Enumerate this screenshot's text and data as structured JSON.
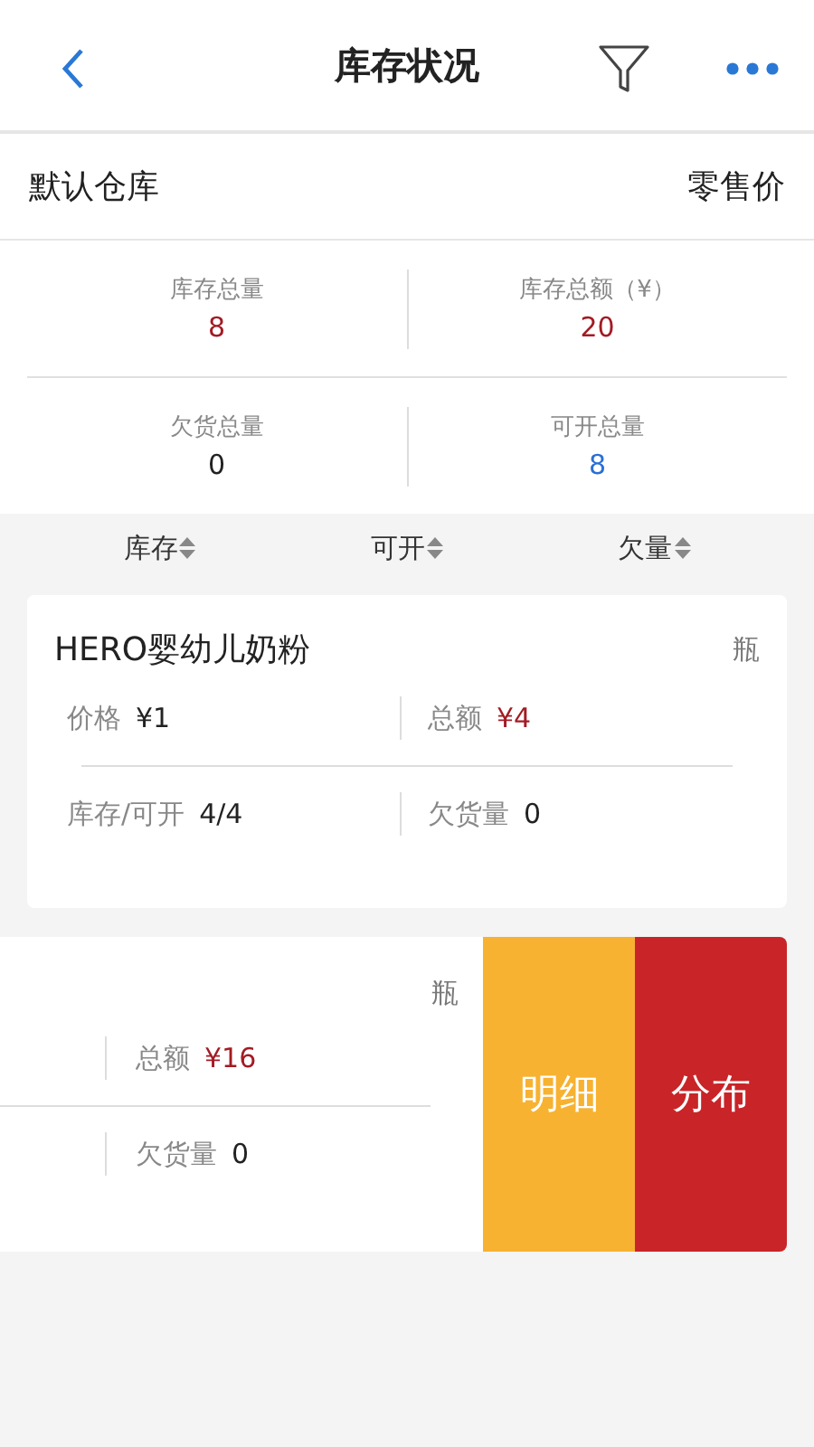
{
  "header": {
    "title": "库存状况"
  },
  "warehouse": {
    "name": "默认仓库",
    "price_type": "零售价"
  },
  "stats": [
    {
      "label": "库存总量",
      "value": "8",
      "color": "#a31b24"
    },
    {
      "label": "库存总额（¥）",
      "value": "20",
      "color": "#a31b24"
    },
    {
      "label": "欠货总量",
      "value": "0",
      "color": "#222222"
    },
    {
      "label": "可开总量",
      "value": "8",
      "color": "#2a6fd6"
    }
  ],
  "sort_columns": [
    "库存",
    "可开",
    "欠量"
  ],
  "items": [
    {
      "kind": "full",
      "name": "HERO婴幼儿奶粉",
      "unit": "瓶",
      "price_label": "价格",
      "price": "¥1",
      "total_label": "总额",
      "total": "¥4",
      "stock_label": "库存/可开",
      "stock": "4/4",
      "owed_label": "欠货量",
      "owed": "0"
    },
    {
      "kind": "swiped",
      "unit": "瓶",
      "total_label": "总额",
      "total": "¥16",
      "owed_label": "欠货量",
      "owed": "0",
      "actions": [
        {
          "label": "明细",
          "color": "#f7b231"
        },
        {
          "label": "分布",
          "color": "#c92428"
        }
      ]
    }
  ]
}
